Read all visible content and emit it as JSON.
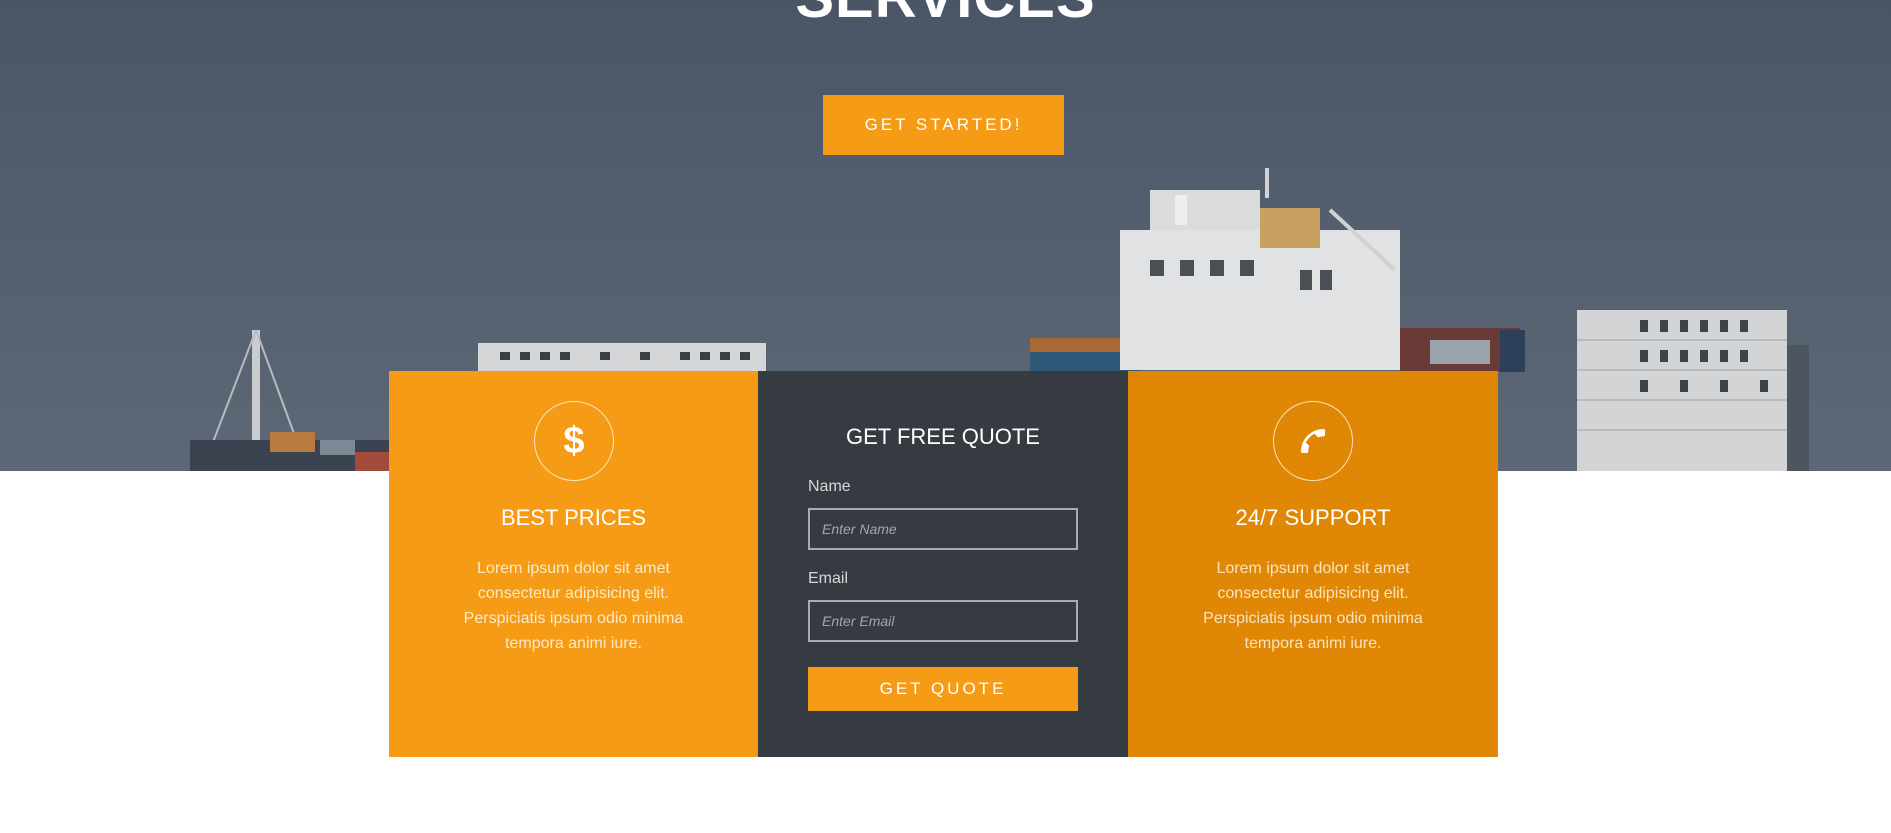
{
  "hero": {
    "title": "SERVICES",
    "cta_label": "GET STARTED!"
  },
  "features": {
    "left": {
      "icon": "dollar-icon",
      "title": "BEST PRICES",
      "text": "Lorem ipsum dolor sit amet consectetur adipisicing elit. Perspiciatis ipsum odio minima tempora animi iure."
    },
    "right": {
      "icon": "phone-icon",
      "title": "24/7 SUPPORT",
      "text": "Lorem ipsum dolor sit amet consectetur adipisicing elit. Perspiciatis ipsum odio minima tempora animi iure."
    }
  },
  "quote_form": {
    "title": "GET FREE QUOTE",
    "name_label": "Name",
    "name_placeholder": "Enter Name",
    "email_label": "Email",
    "email_placeholder": "Enter Email",
    "submit_label": "GET QUOTE"
  },
  "colors": {
    "accent": "#f59b15",
    "accent_dark": "#e08806",
    "panel_dark": "#363a41",
    "hero_bg": "#4f5a69"
  }
}
